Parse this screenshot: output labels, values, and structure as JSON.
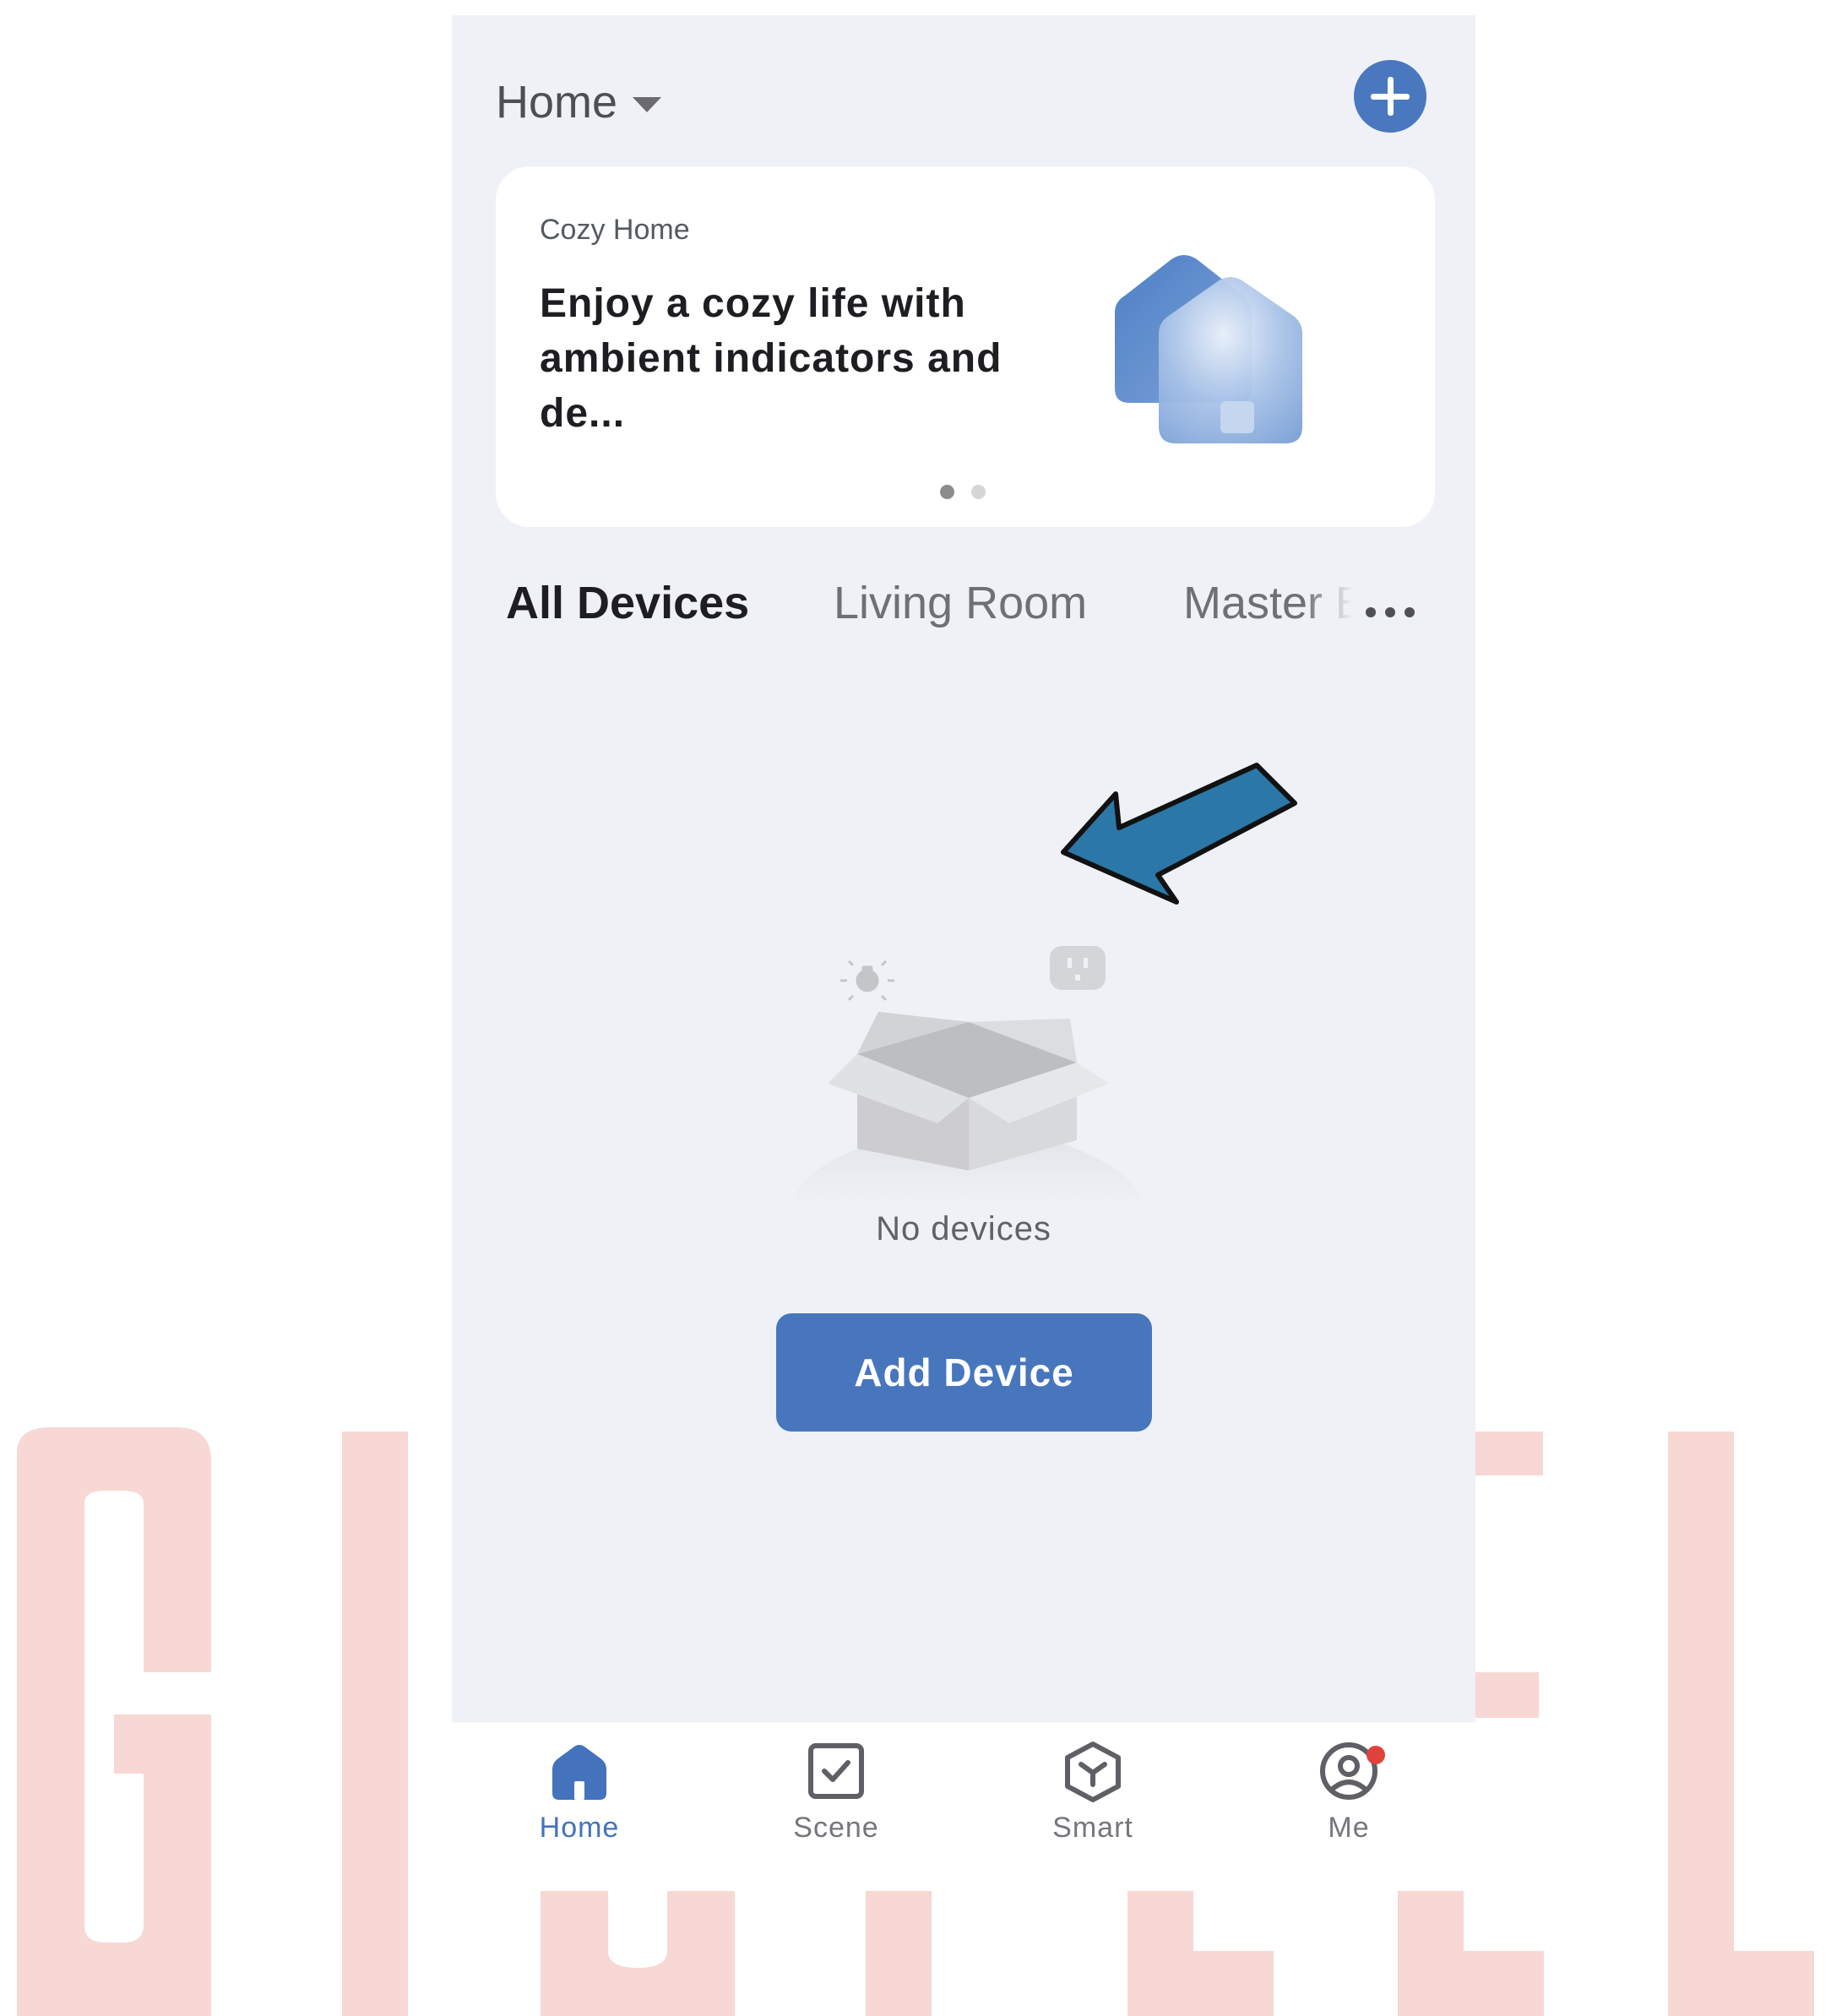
{
  "header": {
    "home_selector_label": "Home",
    "add_icon": "plus-icon"
  },
  "banner": {
    "kicker": "Cozy Home",
    "text": "Enjoy a cozy life with ambient indicators and de...",
    "page_count": 2,
    "active_page": 1
  },
  "tabs": {
    "items": [
      "All Devices",
      "Living Room",
      "Master B"
    ],
    "active": "All Devices",
    "more_icon": "ellipsis-icon"
  },
  "empty_state": {
    "message": "No devices",
    "button_label": "Add Device"
  },
  "bottom_nav": {
    "items": [
      {
        "label": "Home",
        "icon": "home-icon",
        "active": true
      },
      {
        "label": "Scene",
        "icon": "scene-checkbox-icon",
        "active": false
      },
      {
        "label": "Smart",
        "icon": "smart-cube-icon",
        "active": false
      },
      {
        "label": "Me",
        "icon": "profile-icon",
        "active": false,
        "badge": true
      }
    ]
  },
  "colors": {
    "accent": "#4776bd",
    "screen_background": "#eff1f6",
    "badge": "#e0413d",
    "watermark": "#f7d8d4",
    "arrow": "#2b77a8"
  }
}
